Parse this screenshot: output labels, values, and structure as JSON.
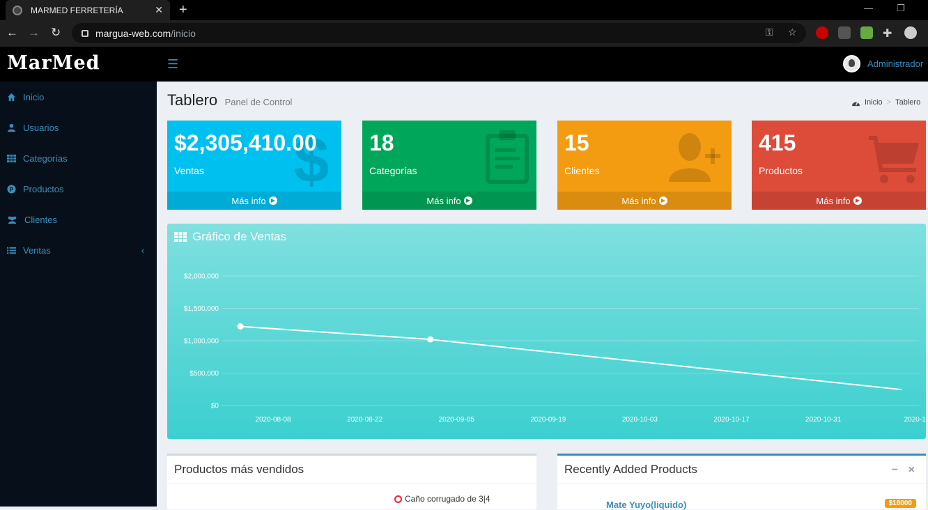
{
  "browser": {
    "tab_title": "MARMED FERRETERÍA",
    "url_domain": "margua-web.com",
    "url_path": "/inicio"
  },
  "app": {
    "logo": "MarMed",
    "user_name": "Administrador"
  },
  "sidebar": {
    "items": [
      {
        "label": "Inicio",
        "icon": "home-icon"
      },
      {
        "label": "Usuarios",
        "icon": "user-icon"
      },
      {
        "label": "Categorías",
        "icon": "grid-icon"
      },
      {
        "label": "Productos",
        "icon": "product-icon"
      },
      {
        "label": "Clientes",
        "icon": "users-icon"
      },
      {
        "label": "Ventas",
        "icon": "list-icon"
      }
    ]
  },
  "header": {
    "title": "Tablero",
    "subtitle": "Panel de Control",
    "breadcrumb": [
      "Inicio",
      "Tablero"
    ]
  },
  "boxes": [
    {
      "value": "$2,305,410.00",
      "label": "Ventas",
      "footer": "Más info",
      "color": "#00c0ef",
      "icon": "dollar-icon"
    },
    {
      "value": "18",
      "label": "Categorías",
      "footer": "Más info",
      "color": "#00a65a",
      "icon": "clipboard-icon"
    },
    {
      "value": "15",
      "label": "Clientes",
      "footer": "Más info",
      "color": "#f39c12",
      "icon": "user-plus-icon"
    },
    {
      "value": "415",
      "label": "Productos",
      "footer": "Más info",
      "color": "#dd4b39",
      "icon": "cart-icon"
    }
  ],
  "chart_section": {
    "title": "Gráfico de Ventas"
  },
  "chart_data": {
    "type": "line",
    "title": "",
    "xlabel": "",
    "ylabel": "",
    "ylim": [
      0,
      2000000
    ],
    "y_ticks": [
      "$0",
      "$500,000",
      "$1,000,000",
      "$1,500,000",
      "$2,000,000"
    ],
    "x_ticks": [
      "2020-08-08",
      "2020-08-22",
      "2020-09-05",
      "2020-09-19",
      "2020-10-03",
      "2020-10-17",
      "2020-10-31",
      "2020-1"
    ],
    "points": [
      {
        "x": "2020-08-03",
        "y": 1220000
      },
      {
        "x": "2020-09-01",
        "y": 1020000
      },
      {
        "x": "2020-11-12",
        "y": 245000
      }
    ],
    "grid": true,
    "line_color": "#ffffff"
  },
  "panels": {
    "left_title": "Productos más vendidos",
    "left_legend_item": "Caño corrugado de 3|4",
    "right_title": "Recently Added Products",
    "right_first_product": "Mate Yuyo(liquido)",
    "right_first_price": "$18000"
  }
}
